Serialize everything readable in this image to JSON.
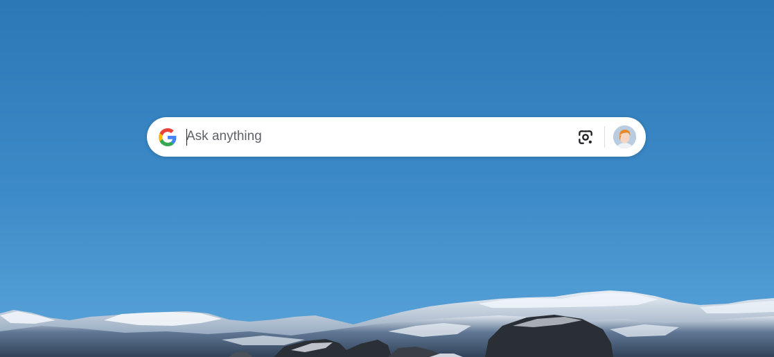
{
  "search": {
    "placeholder": "Ask anything",
    "value": ""
  },
  "icons": {
    "logo": "google-g-logo",
    "lens": "camera-lens-icon",
    "avatar": "user-avatar"
  },
  "colors": {
    "sky_top": "#2f7ab8",
    "sky_bottom": "#5aa3d8",
    "search_bg": "#ffffff",
    "placeholder": "#5f6368",
    "google_blue": "#4285F4",
    "google_red": "#EA4335",
    "google_yellow": "#FBBC05",
    "google_green": "#34A853"
  }
}
